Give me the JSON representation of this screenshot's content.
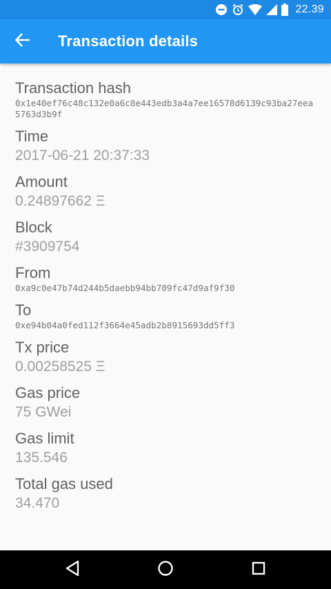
{
  "status_bar": {
    "time": "22.39",
    "icons": [
      "do-not-disturb-icon",
      "alarm-icon",
      "wifi-icon",
      "signal-icon",
      "battery-icon"
    ]
  },
  "app_bar": {
    "title": "Transaction details",
    "back_icon": "arrow-back-icon",
    "color": "#2196f3"
  },
  "details": {
    "hash_label": "Transaction hash",
    "hash_value": "0x1e40ef76c48c132e0a6c8e443edb3a4a7ee16578d6139c93ba27eea5763d3b9f",
    "time_label": "Time",
    "time_value": "2017-06-21 20:37:33",
    "amount_label": "Amount",
    "amount_value": "0.24897662 Ξ",
    "block_label": "Block",
    "block_value": "#3909754",
    "from_label": "From",
    "from_value": "0xa9c0e47b74d244b5daebb94bb709fc47d9af9f30",
    "to_label": "To",
    "to_value": "0xe94b04a0fed112f3664e45adb2b8915693dd5ff3",
    "tx_price_label": "Tx price",
    "tx_price_value": "0.00258525 Ξ",
    "gas_price_label": "Gas price",
    "gas_price_value": "75 GWei",
    "gas_limit_label": "Gas limit",
    "gas_limit_value": "135.546",
    "gas_used_label": "Total gas used",
    "gas_used_value": "34.470"
  },
  "nav_bar": {
    "icons": [
      "back-triangle-icon",
      "home-circle-icon",
      "recents-square-icon"
    ]
  }
}
